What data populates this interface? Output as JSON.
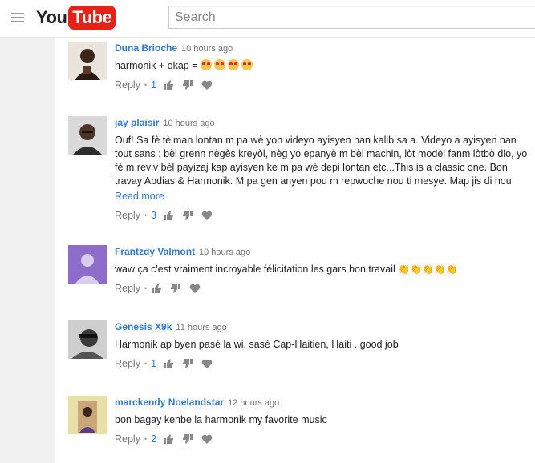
{
  "header": {
    "logo_you": "You",
    "logo_tube": "Tube",
    "search_placeholder": "Search"
  },
  "comments": [
    {
      "author": "Duna Brioche",
      "time": "10 hours ago",
      "text": "harmonik + okap = ",
      "emojis": [
        "heart-eyes-emoji",
        "heart-eyes-emoji",
        "heart-eyes-emoji",
        "heart-eyes-emoji"
      ],
      "reply": "Reply",
      "likes": "1"
    },
    {
      "author": "jay plaisir",
      "time": "10 hours ago",
      "text": "Ouf! Sa fè tèlman lontan m pa wè yon videyo ayisyen nan kalib sa a. Videyo a ayisyen nan tout sans : bèl grenn nègès kreyòl, nèg yo epanyè m bèl machin, lòt modèl fanm lòtbò dlo, yo fè m reviv bèl payizaj kap ayisyen ke m pa wè depi lontan etc...This is a classic one. Bon travay Abdias & Harmonik. M pa gen anyen pou m repwoche nou ti mesye. Map jis di nou",
      "read_more": "Read more",
      "reply": "Reply",
      "likes": "3"
    },
    {
      "author": "Frantzdy Valmont",
      "time": "10 hours ago",
      "text": "waw ça c'est vraiment incroyable félicitation les gars  bon travail ",
      "emojis": [
        "clap-emoji",
        "clap-emoji",
        "clap-emoji",
        "clap-emoji",
        "clap-emoji"
      ],
      "reply": "Reply",
      "likes": ""
    },
    {
      "author": "Genesis X9k",
      "time": "11 hours ago",
      "text": "Harmonik ap byen pasé la wi. sasé Cap-Haitien, Haiti . good job",
      "reply": "Reply",
      "likes": "1"
    },
    {
      "author": "marckendy Noelandstar",
      "time": "12 hours ago",
      "text": "bon bagay kenbe la harmonik my favorite music",
      "reply": "Reply",
      "likes": "2"
    }
  ]
}
